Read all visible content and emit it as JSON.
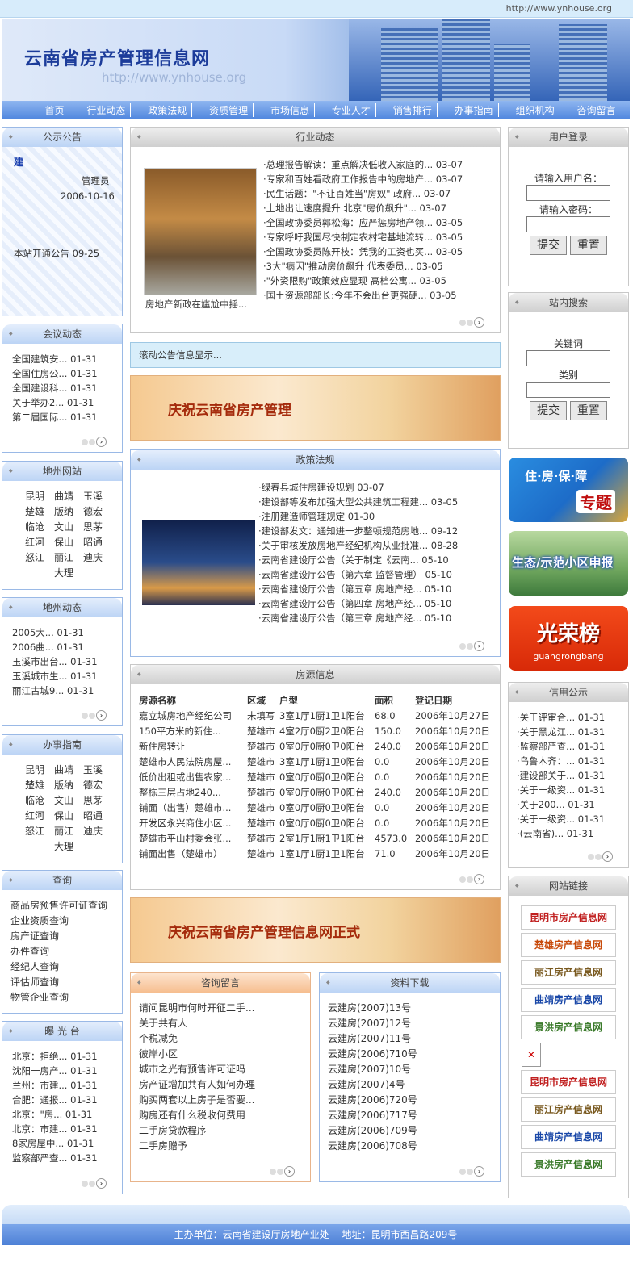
{
  "site": {
    "url": "http://www.ynhouse.org",
    "title": "云南省房产管理信息网",
    "banner_url": "http://www.ynhouse.org"
  },
  "nav": [
    "首页",
    "行业动态",
    "政策法规",
    "资质管理",
    "市场信息",
    "专业人才",
    "销售排行",
    "办事指南",
    "组织机构",
    "咨询留言"
  ],
  "notice": {
    "title": "公示公告",
    "heading": "建",
    "author": "管理员",
    "date": "2006-10-16",
    "item": "本站开通公告 09-25"
  },
  "meeting": {
    "title": "会议动态",
    "items": [
      "全国建筑安... 01-31",
      "全国住房公... 01-31",
      "全国建设科... 01-31",
      "关于举办2... 01-31",
      "第二届国际... 01-31"
    ]
  },
  "cities": {
    "title": "地州网站",
    "items": [
      "昆明",
      "曲靖",
      "玉溪",
      "楚雄",
      "版纳",
      "德宏",
      "临沧",
      "文山",
      "思茅",
      "红河",
      "保山",
      "昭通",
      "怒江",
      "丽江",
      "迪庆",
      "大理"
    ]
  },
  "city_news": {
    "title": "地州动态",
    "items": [
      "2005大... 01-31",
      "2006曲... 01-31",
      "玉溪市出台... 01-31",
      "玉溪城市生... 01-31",
      "丽江古城9... 01-31"
    ]
  },
  "guide": {
    "title": "办事指南",
    "items": [
      "昆明",
      "曲靖",
      "玉溪",
      "楚雄",
      "版纳",
      "德宏",
      "临沧",
      "文山",
      "思茅",
      "红河",
      "保山",
      "昭通",
      "怒江",
      "丽江",
      "迪庆",
      "大理"
    ]
  },
  "query": {
    "title": "查询",
    "items": [
      "商品房预售许可证查询",
      "企业资质查询",
      "房产证查询",
      "办件查询",
      "经纪人查询",
      "评估师查询",
      "物管企业查询"
    ]
  },
  "exposure": {
    "title": "曝 光 台",
    "items": [
      "北京：拒绝... 01-31",
      "沈阳一房产... 01-31",
      "兰州：市建... 01-31",
      "合肥：通报... 01-31",
      "北京：\"房... 01-31",
      "北京：市建... 01-31",
      "8家房屋中... 01-31",
      "监察部严查... 01-31"
    ]
  },
  "industry": {
    "title": "行业动态",
    "caption": "房地产新政在尴尬中摇...",
    "items": [
      "·总理报告解读：重点解决低收入家庭的... 03-07",
      "·专家和百姓看政府工作报告中的房地产... 03-07",
      "·民生话题：\"不让百姓当\"房奴\" 政府... 03-07",
      "·土地出让速度提升 北京\"房价飙升\"... 03-07",
      "·全国政协委员郭松海：应严惩房地产领... 03-05",
      "·专家呼吁我国尽快制定农村宅基地流转... 03-05",
      "·全国政协委员陈开枝：凭我的工资也买... 03-05",
      "·3大\"病因\"推动房价飙升 代表委员... 03-05",
      "·\"外资限购\"政策效应显现 高档公寓... 03-05",
      "·国土资源部部长:今年不会出台更强硬... 03-05"
    ]
  },
  "scroll_notice": "滚动公告信息显示...",
  "promo1": "庆祝云南省房产管理",
  "policy": {
    "title": "政策法规",
    "items": [
      "·绿春县城住房建设规划 03-07",
      "·建设部等发布加强大型公共建筑工程建... 03-05",
      "·注册建造师管理规定 01-30",
      "·建设部发文：通知进一步整顿规范房地... 09-12",
      "·关于审核发放房地产经纪机构从业批准... 08-28",
      "·云南省建设厅公告（关于制定《云南... 05-10",
      "·云南省建设厅公告（第六章 监督管理） 05-10",
      "·云南省建设厅公告（第五章 房地产经... 05-10",
      "·云南省建设厅公告（第四章 房地产经... 05-10",
      "·云南省建设厅公告（第三章 房地产经... 05-10"
    ]
  },
  "source": {
    "title": "房源信息",
    "headers": [
      "房源名称",
      "区域",
      "户型",
      "面积",
      "登记日期"
    ],
    "rows": [
      [
        "嘉立城房地产经纪公司",
        "未填写",
        "3室1厅1厨1卫1阳台",
        "68.0",
        "2006年10月27日"
      ],
      [
        "150平方米的新住...",
        "楚雄市",
        "4室2厅0厨2卫0阳台",
        "150.0",
        "2006年10月20日"
      ],
      [
        "新住房转让",
        "楚雄市",
        "0室0厅0厨0卫0阳台",
        "240.0",
        "2006年10月20日"
      ],
      [
        "楚雄市人民法院房屋...",
        "楚雄市",
        "3室1厅1厨1卫0阳台",
        "0.0",
        "2006年10月20日"
      ],
      [
        "低价出租或出售农家...",
        "楚雄市",
        "0室0厅0厨0卫0阳台",
        "0.0",
        "2006年10月20日"
      ],
      [
        "整栋三层占地240...",
        "楚雄市",
        "0室0厅0厨0卫0阳台",
        "240.0",
        "2006年10月20日"
      ],
      [
        "铺面（出售）楚雄市...",
        "楚雄市",
        "0室0厅0厨0卫0阳台",
        "0.0",
        "2006年10月20日"
      ],
      [
        "开发区永兴商住小区...",
        "楚雄市",
        "0室0厅0厨0卫0阳台",
        "0.0",
        "2006年10月20日"
      ],
      [
        "楚雄市平山村委会张...",
        "楚雄市",
        "2室1厅1厨1卫1阳台",
        "4573.0",
        "2006年10月20日"
      ],
      [
        "铺面出售（楚雄市）",
        "楚雄市",
        "1室1厅1厨1卫1阳台",
        "71.0",
        "2006年10月20日"
      ]
    ]
  },
  "promo2": "庆祝云南省房产管理信息网正式",
  "consult": {
    "title": "咨询留言",
    "items": [
      "请问昆明市何时开征二手...",
      "关于共有人",
      "个税减免",
      "彼岸小区",
      "城市之光有预售许可证吗",
      "房产证增加共有人如何办理",
      "购买两套以上房子是否要...",
      "购房还有什么税收何费用",
      "二手房贷款程序",
      "二手房赠予"
    ]
  },
  "download": {
    "title": "资料下载",
    "items": [
      "云建房(2007)13号",
      "云建房(2007)12号",
      "云建房(2007)11号",
      "云建房(2006)710号",
      "云建房(2007)10号",
      "云建房(2007)4号",
      "云建房(2006)720号",
      "云建房(2006)717号",
      "云建房(2006)709号",
      "云建房(2006)708号"
    ]
  },
  "login": {
    "title": "用户登录",
    "user_label": "请输入用户名：",
    "pass_label": "请输入密码：",
    "submit": "提交",
    "reset": "重置"
  },
  "search": {
    "title": "站内搜索",
    "keyword_label": "关键词",
    "category_label": "类别",
    "submit": "提交",
    "reset": "重置"
  },
  "ads": {
    "a1": "住·房·保·障",
    "a1b": "专题",
    "a2": "生态/示范小区申报",
    "a3": "光荣榜",
    "a3b": "guangrongbang"
  },
  "credit": {
    "title": "信用公示",
    "items": [
      "·关于评审合... 01-31",
      "·关于黑龙江... 01-31",
      "·监察部严查... 01-31",
      "·乌鲁木齐：... 01-31",
      "·建设部关于... 01-31",
      "·关于一级资... 01-31",
      "·关于200... 01-31",
      "·关于一级资... 01-31",
      "·(云南省)... 01-31"
    ]
  },
  "links": {
    "title": "网站链接",
    "items": [
      "昆明市房产信息网",
      "楚雄房产信息网",
      "丽江房产信息网",
      "曲靖房产信息网",
      "景洪房产信息网",
      "",
      "昆明市房产信息网",
      "丽江房产信息网",
      "曲靖房产信息网",
      "景洪房产信息网"
    ]
  },
  "footer": "主办单位：云南省建设厅房地产业处　 地址：昆明市西昌路209号",
  "colors": {
    "nav": "#4f86de",
    "accent": "#a52b0c"
  }
}
